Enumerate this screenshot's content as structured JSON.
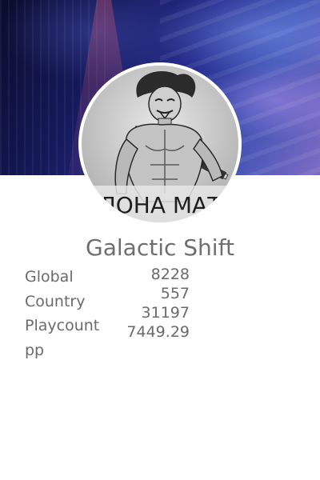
{
  "profile": {
    "username": "Galactic Shift",
    "avatar_caption": "ЛОНА МАТ"
  },
  "stats": {
    "labels": [
      "Global",
      "Country",
      "Playcount",
      "pp"
    ],
    "values": [
      "8228",
      "557",
      "31197",
      "7449.29"
    ]
  },
  "colors": {
    "banner_dark": "#0a0c2c",
    "banner_blue": "#3e52b4",
    "banner_purple": "#7e6cc4",
    "text_gray": "#6a6a6a"
  }
}
